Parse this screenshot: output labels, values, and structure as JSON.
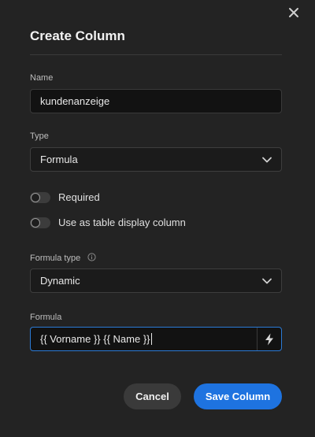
{
  "dialog": {
    "title": "Create Column"
  },
  "fields": {
    "name": {
      "label": "Name",
      "value": "kundenanzeige"
    },
    "type": {
      "label": "Type",
      "value": "Formula"
    },
    "required": {
      "label": "Required",
      "checked": false
    },
    "display_column": {
      "label": "Use as table display column",
      "checked": false
    },
    "formula_type": {
      "label": "Formula type",
      "value": "Dynamic",
      "info_icon": "info-icon"
    },
    "formula": {
      "label": "Formula",
      "value": "{{ Vorname }} {{ Name }}",
      "action_icon": "bolt-icon"
    }
  },
  "buttons": {
    "cancel_label": "Cancel",
    "save_label": "Save Column"
  },
  "colors": {
    "accent": "#1e73e0",
    "focus_border": "#2b7bd6",
    "background": "#232323"
  }
}
